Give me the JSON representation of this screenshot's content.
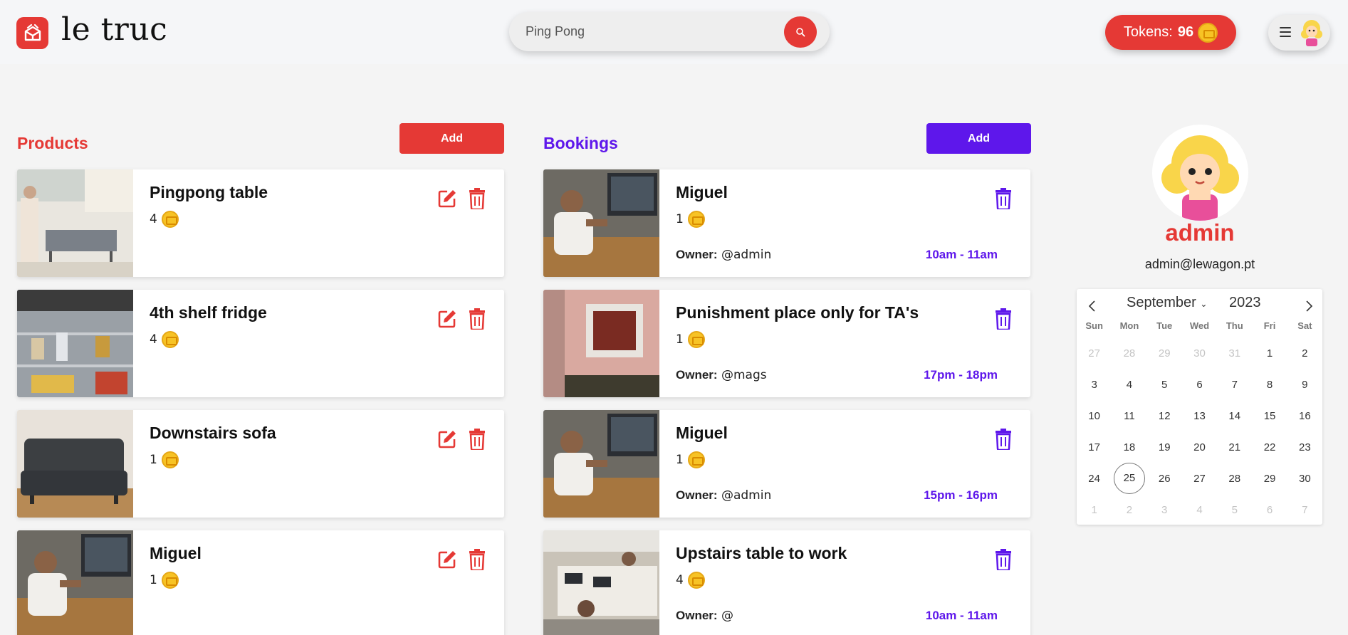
{
  "navbar": {
    "brand": "le truc",
    "search_value": "Ping Pong",
    "tokens_label": "Tokens:",
    "tokens_count": "96"
  },
  "colors": {
    "red": "#e53935",
    "purple": "#5e17eb",
    "gold": "#f7c325"
  },
  "products": {
    "title": "Products",
    "add_label": "Add",
    "items": [
      {
        "title": "Pingpong table",
        "price": "4"
      },
      {
        "title": "4th shelf fridge",
        "price": "4"
      },
      {
        "title": "Downstairs sofa",
        "price": "1"
      },
      {
        "title": "Miguel",
        "price": "1"
      }
    ]
  },
  "bookings": {
    "title": "Bookings",
    "add_label": "Add",
    "owner_label": "Owner:",
    "items": [
      {
        "title": "Miguel",
        "price": "1",
        "owner": "@admin",
        "time": "10am - 11am"
      },
      {
        "title": "Punishment place only for TA's",
        "price": "1",
        "owner": "@mags",
        "time": "17pm - 18pm"
      },
      {
        "title": "Miguel",
        "price": "1",
        "owner": "@admin",
        "time": "15pm - 16pm"
      },
      {
        "title": "Upstairs table to work",
        "price": "4",
        "owner": "@",
        "time": "10am - 11am"
      }
    ]
  },
  "profile": {
    "name": "admin",
    "email": "admin@lewagon.pt"
  },
  "calendar": {
    "month": "September",
    "year": "2023",
    "weekdays": [
      "Sun",
      "Mon",
      "Tue",
      "Wed",
      "Thu",
      "Fri",
      "Sat"
    ],
    "weeks": [
      [
        "27",
        "28",
        "29",
        "30",
        "31",
        "1",
        "2"
      ],
      [
        "3",
        "4",
        "5",
        "6",
        "7",
        "8",
        "9"
      ],
      [
        "10",
        "11",
        "12",
        "13",
        "14",
        "15",
        "16"
      ],
      [
        "17",
        "18",
        "19",
        "20",
        "21",
        "22",
        "23"
      ],
      [
        "24",
        "25",
        "26",
        "27",
        "28",
        "29",
        "30"
      ],
      [
        "1",
        "2",
        "3",
        "4",
        "5",
        "6",
        "7"
      ]
    ],
    "selected_day": "25"
  }
}
